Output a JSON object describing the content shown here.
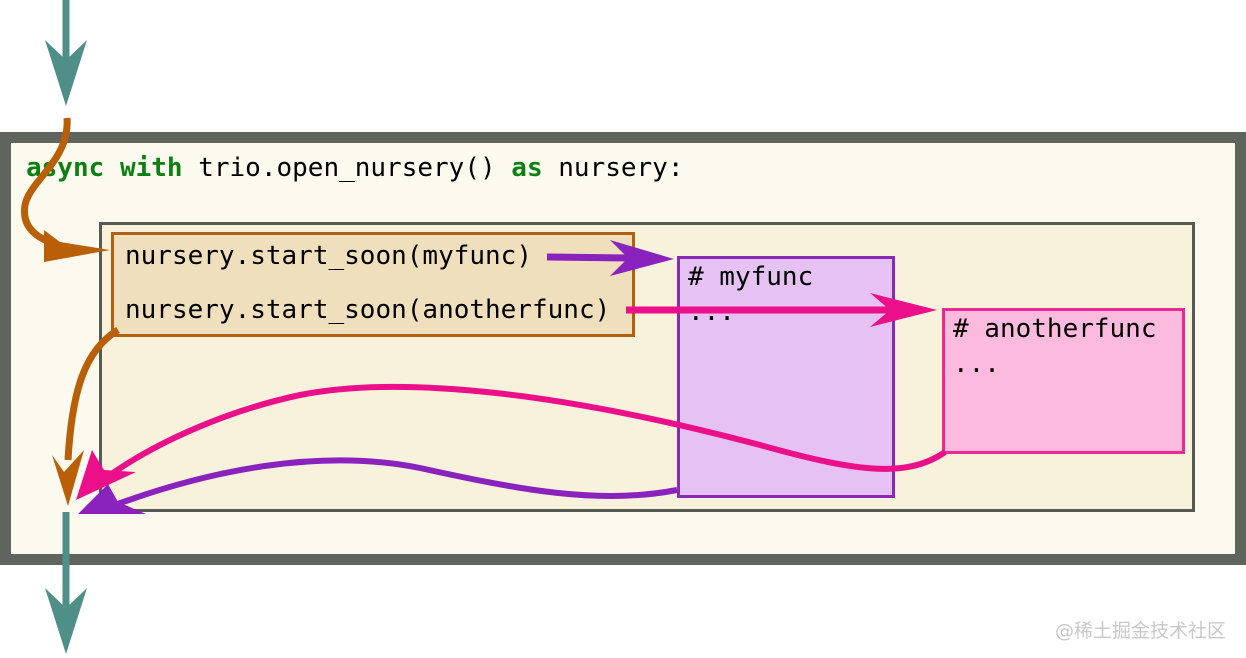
{
  "header_line": {
    "kw_async": "async",
    "kw_with": "with",
    "call": "trio.open_nursery()",
    "kw_as": "as",
    "target": "nursery:"
  },
  "code_box": {
    "line1": "nursery.start_soon(myfunc)",
    "line2": "nursery.start_soon(anotherfunc)"
  },
  "myfunc_box": {
    "title": "# myfunc",
    "body": "..."
  },
  "anotherfunc_box": {
    "title": "# anotherfunc",
    "body": "..."
  },
  "watermark": "@稀土掘金技术社区",
  "colors": {
    "flow_teal": "#4f8f87",
    "flow_orange": "#b85f08",
    "arrow_purple": "#8a22bd",
    "arrow_pink": "#ec0f8a",
    "keyword_green": "#0e8013"
  }
}
